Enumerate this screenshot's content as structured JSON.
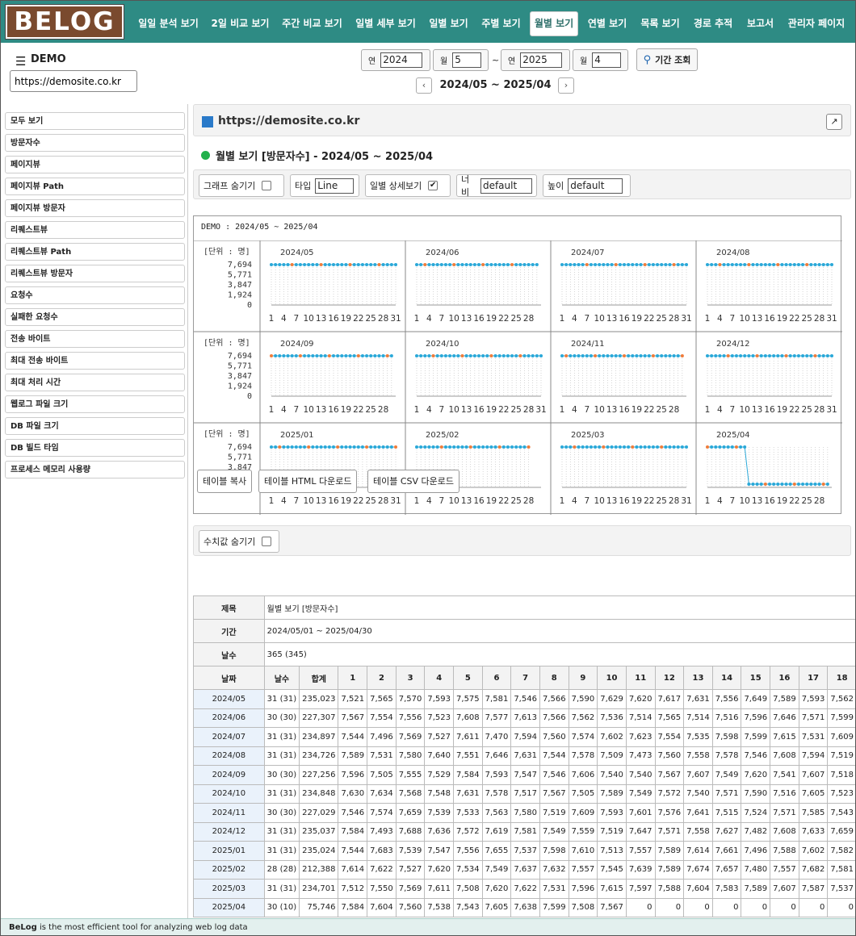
{
  "logo_text": "BELOG",
  "nav": [
    "일일 분석 보기",
    "2일 비교 보기",
    "주간 비교 보기",
    "일별 세부 보기",
    "일별 보기",
    "주별 보기",
    "월별 보기",
    "연별 보기",
    "목록 보기",
    "경로 추적",
    "보고서",
    "관리자 페이지"
  ],
  "nav_active_index": 6,
  "site": {
    "menu_icon": "hamburger-icon",
    "menu_glyph": "☰",
    "name": "DEMO",
    "url": "https://demosite.co.kr"
  },
  "date_range": {
    "from": {
      "year_label": "연",
      "year": "2024",
      "month_label": "월",
      "month": "5"
    },
    "tilde": "~",
    "to": {
      "year_label": "연",
      "year": "2025",
      "month_label": "월",
      "month": "4"
    },
    "search_label": "기간 조회",
    "prev": "‹",
    "next": "›",
    "period": "2024/05 ~ 2025/04"
  },
  "sidebar": [
    "모두 보기",
    "방문자수",
    "페이지뷰",
    "페이지뷰 Path",
    "페이지뷰 방문자",
    "리퀘스트뷰",
    "리퀘스트뷰 Path",
    "리퀘스트뷰 방문자",
    "요청수",
    "실패한 요청수",
    "전송 바이트",
    "최대 전송 바이트",
    "최대 처리 시간",
    "웹로그 파일 크기",
    "DB 파일 크기",
    "DB 빌드 타임",
    "프로세스 메모리 사용량"
  ],
  "main": {
    "site_title": "https://demosite.co.kr",
    "expand_glyph": "↗",
    "heading": "월별 보기 [방문자수] - 2024/05 ~ 2025/04",
    "options": {
      "hide_graph": "그래프 숨기기",
      "type_label": "타입",
      "type_value": "Line",
      "daily_detail": "일별 상세보기",
      "daily_detail_checked": "✔",
      "width_label": "너비",
      "width_value": "default",
      "height_label": "높이",
      "height_value": "default"
    },
    "hide_values": "수치값 숨기기",
    "buttons": {
      "copy": "테이블 복사",
      "html": "테이블 HTML 다운로드",
      "csv": "테이블 CSV 다운로드"
    }
  },
  "chart_data": {
    "type": "line",
    "title": "DEMO : 2024/05 ~ 2025/04",
    "unit_label": "[단위 : 명]",
    "y_ticks": [
      7694,
      5771,
      3847,
      1924,
      0
    ],
    "y_tick_labels": [
      "7,694",
      "5,771",
      "3,847",
      "1,924",
      "0"
    ],
    "ylim": [
      0,
      7694
    ],
    "x_tick_labels": [
      "1",
      "4",
      "7",
      "10",
      "13",
      "16",
      "19",
      "22",
      "25",
      "28",
      "31"
    ],
    "colors": {
      "line": "#2aa8d8",
      "point": "#2aa8d8",
      "weekend_point": "#f07c3a"
    },
    "months": [
      {
        "label": "2024/05",
        "days": 31,
        "active_days": 31
      },
      {
        "label": "2024/06",
        "days": 30,
        "active_days": 30
      },
      {
        "label": "2024/07",
        "days": 31,
        "active_days": 31
      },
      {
        "label": "2024/08",
        "days": 31,
        "active_days": 31
      },
      {
        "label": "2024/09",
        "days": 30,
        "active_days": 30
      },
      {
        "label": "2024/10",
        "days": 31,
        "active_days": 31
      },
      {
        "label": "2024/11",
        "days": 30,
        "active_days": 30
      },
      {
        "label": "2024/12",
        "days": 31,
        "active_days": 31
      },
      {
        "label": "2025/01",
        "days": 31,
        "active_days": 31
      },
      {
        "label": "2025/02",
        "days": 28,
        "active_days": 28
      },
      {
        "label": "2025/03",
        "days": 31,
        "active_days": 31
      },
      {
        "label": "2025/04",
        "days": 30,
        "active_days": 10
      }
    ]
  },
  "table": {
    "meta": [
      {
        "label": "제목",
        "value": "월별 보기 [방문자수]"
      },
      {
        "label": "기간",
        "value": "2024/05/01 ~ 2025/04/30"
      },
      {
        "label": "날수",
        "value": "365 (345)"
      }
    ],
    "headers": [
      "날짜",
      "날수",
      "합계",
      "1",
      "2",
      "3",
      "4",
      "5",
      "6",
      "7",
      "8",
      "9",
      "10",
      "11",
      "12",
      "13",
      "14",
      "15",
      "16",
      "17",
      "18"
    ],
    "rows": [
      [
        "2024/05",
        "31 (31)",
        "235,023",
        "7,521",
        "7,565",
        "7,570",
        "7,593",
        "7,575",
        "7,581",
        "7,546",
        "7,566",
        "7,590",
        "7,629",
        "7,620",
        "7,617",
        "7,631",
        "7,556",
        "7,649",
        "7,589",
        "7,593",
        "7,562"
      ],
      [
        "2024/06",
        "30 (30)",
        "227,307",
        "7,567",
        "7,554",
        "7,556",
        "7,523",
        "7,608",
        "7,577",
        "7,613",
        "7,566",
        "7,562",
        "7,536",
        "7,514",
        "7,565",
        "7,514",
        "7,516",
        "7,596",
        "7,646",
        "7,571",
        "7,599"
      ],
      [
        "2024/07",
        "31 (31)",
        "234,897",
        "7,544",
        "7,496",
        "7,569",
        "7,527",
        "7,611",
        "7,470",
        "7,594",
        "7,560",
        "7,574",
        "7,602",
        "7,623",
        "7,554",
        "7,535",
        "7,598",
        "7,599",
        "7,615",
        "7,531",
        "7,609"
      ],
      [
        "2024/08",
        "31 (31)",
        "234,726",
        "7,589",
        "7,531",
        "7,580",
        "7,640",
        "7,551",
        "7,646",
        "7,631",
        "7,544",
        "7,578",
        "7,509",
        "7,473",
        "7,560",
        "7,558",
        "7,578",
        "7,546",
        "7,608",
        "7,594",
        "7,519"
      ],
      [
        "2024/09",
        "30 (30)",
        "227,256",
        "7,596",
        "7,505",
        "7,555",
        "7,529",
        "7,584",
        "7,593",
        "7,547",
        "7,546",
        "7,606",
        "7,540",
        "7,540",
        "7,567",
        "7,607",
        "7,549",
        "7,620",
        "7,541",
        "7,607",
        "7,518"
      ],
      [
        "2024/10",
        "31 (31)",
        "234,848",
        "7,630",
        "7,634",
        "7,568",
        "7,548",
        "7,631",
        "7,578",
        "7,517",
        "7,567",
        "7,505",
        "7,589",
        "7,549",
        "7,572",
        "7,540",
        "7,571",
        "7,590",
        "7,516",
        "7,605",
        "7,523"
      ],
      [
        "2024/11",
        "30 (30)",
        "227,029",
        "7,546",
        "7,574",
        "7,659",
        "7,539",
        "7,533",
        "7,563",
        "7,580",
        "7,519",
        "7,609",
        "7,593",
        "7,601",
        "7,576",
        "7,641",
        "7,515",
        "7,524",
        "7,571",
        "7,585",
        "7,543"
      ],
      [
        "2024/12",
        "31 (31)",
        "235,037",
        "7,584",
        "7,493",
        "7,688",
        "7,636",
        "7,572",
        "7,619",
        "7,581",
        "7,549",
        "7,559",
        "7,519",
        "7,647",
        "7,571",
        "7,558",
        "7,627",
        "7,482",
        "7,608",
        "7,633",
        "7,659"
      ],
      [
        "2025/01",
        "31 (31)",
        "235,024",
        "7,544",
        "7,683",
        "7,539",
        "7,547",
        "7,556",
        "7,655",
        "7,537",
        "7,598",
        "7,610",
        "7,513",
        "7,557",
        "7,589",
        "7,614",
        "7,661",
        "7,496",
        "7,588",
        "7,602",
        "7,582"
      ],
      [
        "2025/02",
        "28 (28)",
        "212,388",
        "7,614",
        "7,622",
        "7,527",
        "7,620",
        "7,534",
        "7,549",
        "7,637",
        "7,632",
        "7,557",
        "7,545",
        "7,639",
        "7,589",
        "7,674",
        "7,657",
        "7,480",
        "7,557",
        "7,682",
        "7,581"
      ],
      [
        "2025/03",
        "31 (31)",
        "234,701",
        "7,512",
        "7,550",
        "7,569",
        "7,611",
        "7,508",
        "7,620",
        "7,622",
        "7,531",
        "7,596",
        "7,615",
        "7,597",
        "7,588",
        "7,604",
        "7,583",
        "7,589",
        "7,607",
        "7,587",
        "7,537"
      ],
      [
        "2025/04",
        "30 (10)",
        "75,746",
        "7,584",
        "7,604",
        "7,560",
        "7,538",
        "7,543",
        "7,605",
        "7,638",
        "7,599",
        "7,508",
        "7,567",
        "0",
        "0",
        "0",
        "0",
        "0",
        "0",
        "0",
        "0"
      ]
    ]
  },
  "footer": {
    "brand": "BeLog",
    "text": " is the most efficient tool for analyzing web log data"
  }
}
